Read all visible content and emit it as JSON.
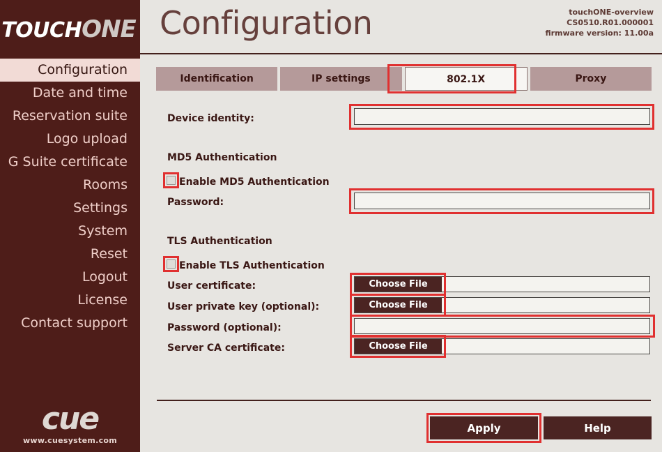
{
  "brand": {
    "logo_primary": "TOUCH",
    "logo_secondary": "ONE",
    "footer_logo": "cue",
    "footer_url": "www.cuesystem.com"
  },
  "header": {
    "title": "Configuration",
    "device_name": "touchONE-overview",
    "device_id": "CS0510.R01.000001",
    "firmware": "firmware version: 11.00a"
  },
  "sidebar": {
    "items": [
      {
        "label": "Configuration",
        "active": true
      },
      {
        "label": "Date and time",
        "active": false
      },
      {
        "label": "Reservation suite",
        "active": false
      },
      {
        "label": "Logo upload",
        "active": false
      },
      {
        "label": "G Suite certificate",
        "active": false
      },
      {
        "label": "Rooms",
        "active": false
      },
      {
        "label": "Settings",
        "active": false
      },
      {
        "label": "System",
        "active": false
      },
      {
        "label": "Reset",
        "active": false
      },
      {
        "label": "Logout",
        "active": false
      },
      {
        "label": "License",
        "active": false
      },
      {
        "label": "Contact support",
        "active": false
      }
    ]
  },
  "tabs": [
    {
      "label": "Identification",
      "active": false
    },
    {
      "label": "IP settings",
      "active": false
    },
    {
      "label": "802.1X",
      "active": true
    },
    {
      "label": "Proxy",
      "active": false
    }
  ],
  "form": {
    "device_identity_label": "Device identity:",
    "device_identity_value": "",
    "md5_section": "MD5 Authentication",
    "md5_enable_label": "Enable MD5 Authentication",
    "md5_enabled": false,
    "md5_password_label": "Password:",
    "md5_password_value": "",
    "tls_section": "TLS Authentication",
    "tls_enable_label": "Enable TLS Authentication",
    "tls_enabled": false,
    "user_cert_label": "User certificate:",
    "user_cert_button": "Choose File",
    "user_cert_value": "",
    "user_key_label": "User private key (optional):",
    "user_key_button": "Choose File",
    "user_key_value": "",
    "tls_password_label": "Password (optional):",
    "tls_password_value": "",
    "server_ca_label": "Server CA certificate:",
    "server_ca_button": "Choose File",
    "server_ca_value": ""
  },
  "footer": {
    "apply_label": "Apply",
    "help_label": "Help"
  },
  "colors": {
    "sidebar_bg": "#4e1d19",
    "content_bg": "#e7e5e1",
    "accent_dark": "#4b2422",
    "tab_inactive": "#b59a9a",
    "active_nav_bg": "#f2dbd6",
    "highlight_red": "#e03030",
    "title_color": "#66403c"
  }
}
